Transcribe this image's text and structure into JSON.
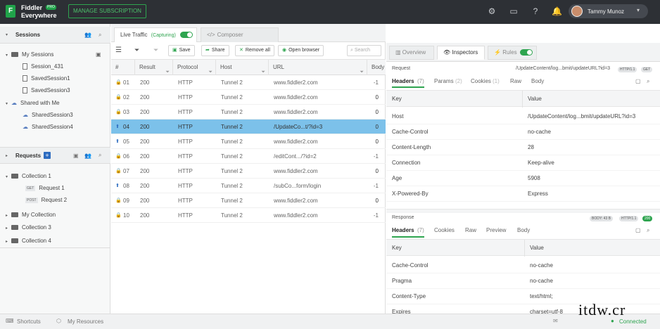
{
  "titlebar": {
    "app_name_line1": "Fiddler",
    "app_name_line2": "Everywhere",
    "pro": "PRO",
    "manage": "MANAGE SUBSCRIPTION",
    "user": "Tammy Munoz"
  },
  "sessions": {
    "title": "Sessions",
    "my_sessions": "My Sessions",
    "items": [
      "Session_431",
      "SavedSession1",
      "SavedSession3"
    ],
    "shared": "Shared with Me",
    "shared_items": [
      "SharedSession3",
      "SharedSession4"
    ]
  },
  "requests": {
    "title": "Requests",
    "collection1": "Collection 1",
    "req1_method": "GET",
    "req1": "Request 1",
    "req2_method": "POST",
    "req2": "Request 2",
    "others": [
      "My Collection",
      "Collection 3",
      "Collection 4"
    ]
  },
  "tabs": {
    "live": "Live Traffic",
    "capturing": "(Capturing)",
    "composer": "Composer"
  },
  "toolbar": {
    "save": "Save",
    "share": "Share",
    "remove_all": "Remove all",
    "open_browser": "Open browser",
    "search_placeholder": "Search"
  },
  "grid": {
    "headers": [
      "#",
      "Result",
      "Protocol",
      "Host",
      "URL",
      "Body"
    ],
    "rows": [
      {
        "num": "01",
        "result": "200",
        "protocol": "HTTP",
        "host": "Tunnel 2",
        "url": "www.fiddler2.com",
        "body": "-1",
        "icon": "lock"
      },
      {
        "num": "02",
        "result": "200",
        "protocol": "HTTP",
        "host": "Tunnel 2",
        "url": "www.fiddler2.com",
        "body": "0",
        "icon": "lock"
      },
      {
        "num": "03",
        "result": "200",
        "protocol": "HTTP",
        "host": "Tunnel 2",
        "url": "www.fiddler2.com",
        "body": "0",
        "icon": "lock"
      },
      {
        "num": "04",
        "result": "200",
        "protocol": "HTTP",
        "host": "Tunnel 2",
        "url": "/UpdateCo...t/?id=3",
        "body": "0",
        "icon": "up",
        "selected": true
      },
      {
        "num": "05",
        "result": "200",
        "protocol": "HTTP",
        "host": "Tunnel 2",
        "url": "www.fiddler2.com",
        "body": "0",
        "icon": "up"
      },
      {
        "num": "06",
        "result": "200",
        "protocol": "HTTP",
        "host": "Tunnel 2",
        "url": "/editCont.../?id=2",
        "body": "-1",
        "icon": "lock"
      },
      {
        "num": "07",
        "result": "200",
        "protocol": "HTTP",
        "host": "Tunnel 2",
        "url": "www.fiddler2.com",
        "body": "0",
        "icon": "lock"
      },
      {
        "num": "08",
        "result": "200",
        "protocol": "HTTP",
        "host": "Tunnel 2",
        "url": "/subCo...form/login",
        "body": "-1",
        "icon": "up"
      },
      {
        "num": "09",
        "result": "200",
        "protocol": "HTTP",
        "host": "Tunnel 2",
        "url": "www.fiddler2.com",
        "body": "0",
        "icon": "lock"
      },
      {
        "num": "10",
        "result": "200",
        "protocol": "HTTP",
        "host": "Tunnel 2",
        "url": "www.fiddler2.com",
        "body": "-1",
        "icon": "lock"
      }
    ]
  },
  "inspector": {
    "tabs": [
      "Overview",
      "Inspectors",
      "Rules"
    ],
    "request": {
      "label": "Request",
      "path": "/UpdateContent/log...bmit/updateURL?id=3",
      "http": "HTTP/1.1",
      "method": "GET",
      "subtabs": [
        "Headers",
        "(7)",
        "Params",
        "(2)",
        "Cookies",
        "(1)",
        "Raw",
        "Body"
      ],
      "key": "Key",
      "value": "Value",
      "headers": [
        [
          "Host",
          "/UpdateContent/log...bmit/updateURL?id=3"
        ],
        [
          "Cache-Control",
          "no-cache"
        ],
        [
          "Content-Length",
          "28"
        ],
        [
          "Connection",
          "Keep-alive"
        ],
        [
          "Age",
          "5908"
        ],
        [
          "X-Powered-By",
          "Express"
        ]
      ]
    },
    "response": {
      "label": "Response",
      "body": "BODY: 43 B",
      "http": "HTTP/1.1",
      "status": "200",
      "subtabs": [
        "Headers",
        "(7)",
        "Cookies",
        "Raw",
        "Preview",
        "Body"
      ],
      "key": "Key",
      "value": "Value",
      "headers": [
        [
          "Cache-Control",
          "no-cache"
        ],
        [
          "Pragma",
          "no-cache"
        ],
        [
          "Content-Type",
          "text/html;"
        ],
        [
          "Expires",
          "charset=utf-8"
        ]
      ]
    }
  },
  "status": {
    "shortcuts": "Shortcuts",
    "resources": "My Resources",
    "connected": "Connected"
  },
  "watermark": "itdw.cr"
}
